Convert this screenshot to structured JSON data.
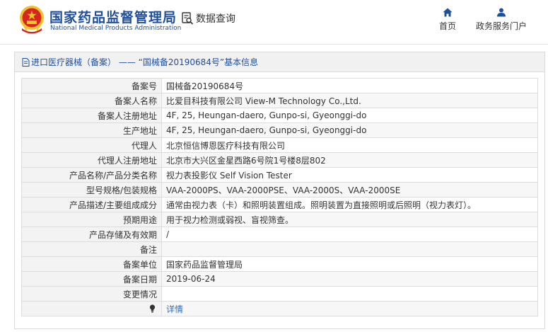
{
  "header": {
    "brand_cn": "国家药品监督管理局",
    "brand_en": "National Medical Products Administration",
    "query_label": "数据查询",
    "nav": [
      {
        "label": "首页",
        "icon": "home-icon"
      },
      {
        "label": "政务服务门户",
        "icon": "user-icon"
      }
    ]
  },
  "panel": {
    "title": "进口医疗器械（备案） —— “国械备20190684号”基本信息"
  },
  "rows": [
    {
      "label": "备案号",
      "value": "国械备20190684号"
    },
    {
      "label": "备案人名称",
      "value": "比爱目科技有限公司 View-M Technology Co.,Ltd."
    },
    {
      "label": "备案人注册地址",
      "value": "4F, 25, Heungan-daero, Gunpo-si, Gyeonggi-do"
    },
    {
      "label": "生产地址",
      "value": "4F, 25, Heungan-daero, Gunpo-si, Gyeonggi-do"
    },
    {
      "label": "代理人",
      "value": "北京恒信博恩医疗科技有限公司"
    },
    {
      "label": "代理人注册地址",
      "value": "北京市大兴区金星西路6号院1号楼8层802"
    },
    {
      "label": "产品名称/产品分类名称",
      "value": "视力表投影仪 Self Vision Tester"
    },
    {
      "label": "型号规格/包装规格",
      "value": "VAA-2000PS、VAA-2000PSE、VAA-2000S、VAA-2000SE"
    },
    {
      "label": "产品描述/主要组成成分",
      "value": "通常由视力表（卡）和照明装置组成。照明装置为直接照明或后照明（视力表灯）。"
    },
    {
      "label": "预期用途",
      "value": "用于视力检测或弱视、盲视筛查。"
    },
    {
      "label": "产品存储及有效期",
      "value": "/"
    },
    {
      "label": "备注",
      "value": ""
    },
    {
      "label": "备案单位",
      "value": "国家药品监督管理局"
    },
    {
      "label": "备案日期",
      "value": "2019-06-24"
    },
    {
      "label": "变更情况",
      "value": ""
    }
  ],
  "detail": {
    "label": "",
    "link": "详情",
    "icon": "lightbulb-icon"
  },
  "colors": {
    "brand": "#1e4f9c",
    "link": "#2f6bc9",
    "emblem_red": "#d7261e",
    "emblem_gold": "#f2c12e"
  }
}
